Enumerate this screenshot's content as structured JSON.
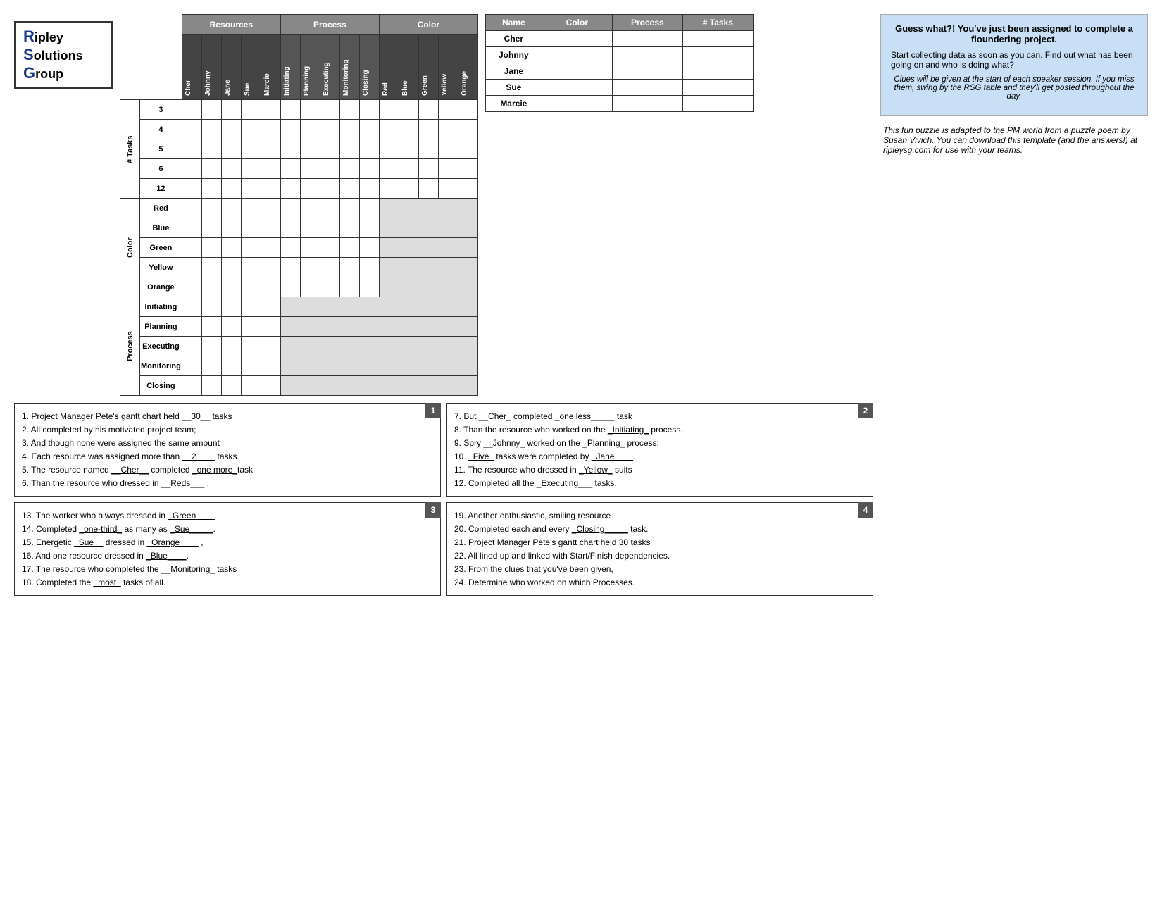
{
  "logo": {
    "line1": "ipley",
    "line2": "olutions",
    "line3": "roup"
  },
  "headers": {
    "resources": "Resources",
    "process": "Process",
    "color": "Color"
  },
  "resource_cols": [
    "Cher",
    "Johnny",
    "Jane",
    "Sue",
    "Marcie"
  ],
  "process_cols": [
    "Initiating",
    "Planning",
    "Executing",
    "Monitoring",
    "Closing"
  ],
  "color_cols": [
    "Red",
    "Blue",
    "Green",
    "Yellow",
    "Orange"
  ],
  "tasks_rows": [
    "3",
    "4",
    "5",
    "6",
    "12"
  ],
  "color_rows": [
    "Red",
    "Blue",
    "Green",
    "Yellow",
    "Orange"
  ],
  "process_rows": [
    "Initiating",
    "Planning",
    "Executing",
    "Monitoring",
    "Closing"
  ],
  "side_labels": {
    "tasks": "# Tasks",
    "color": "Color",
    "process": "Process"
  },
  "answer_table": {
    "headers": [
      "Name",
      "Color",
      "Process",
      "# Tasks"
    ],
    "rows": [
      {
        "name": "Cher"
      },
      {
        "name": "Johnny"
      },
      {
        "name": "Jane"
      },
      {
        "name": "Sue"
      },
      {
        "name": "Marcie"
      }
    ]
  },
  "info_box": {
    "title": "Guess what?! You've just been assigned to complete a floundering project.",
    "body": "Start collecting data as soon as you can.  Find out what has been going on and who is doing what?",
    "italic1": "Clues will be given at the start of each speaker session.  If you miss them, swing by the RSG table and they'll get posted throughout the day.",
    "italic2": "This fun puzzle is adapted to the PM world from a puzzle poem by Susan Vivich.  You can download this template (and the answers!) at ripleysg.com for use with your teams."
  },
  "clue_boxes": [
    {
      "number": "1",
      "clues": [
        "1.  Project Manager Pete's gantt chart held __30__ tasks",
        "2.  All completed by his motivated project team;",
        "3.  And though none were assigned the same amount",
        "4.  Each resource was assigned more than __2____ tasks.",
        "5.  The resource named __Cher__ completed _one more_task",
        "6.  Than the resource who dressed in __Reds___ ,"
      ]
    },
    {
      "number": "2",
      "clues": [
        "7.  But __Cher_ completed _one less_____ task",
        "8.  Than the resource who worked on the _Initiating_ process.",
        "9.  Spry __Johnny_ worked on the _Planning_ process:",
        "10. _Five_ tasks were completed by _Jane____.",
        "11. The resource who dressed in _Yellow_ suits",
        "12. Completed all the _Executing___ tasks."
      ]
    },
    {
      "number": "3",
      "clues": [
        "13. The worker who always dressed in _Green____",
        "14. Completed _one-third_ as many as _Sue_____.",
        "15. Energetic _Sue__ dressed in _Orange____ ,",
        "16. And one resource dressed in _Blue____.",
        "17. The resource who completed the __Monitoring_ tasks",
        "18. Completed the _most_ tasks of all."
      ]
    },
    {
      "number": "4",
      "clues": [
        "19. Another enthusiastic, smiling resource",
        "20. Completed each and every _Closing____ task.",
        "21. Project Manager Pete's gantt chart held 30 tasks",
        "22. All lined up and linked with Start/Finish dependencies.",
        "23. From the clues that you've been given,",
        "24. Determine who worked on which Processes."
      ]
    }
  ]
}
